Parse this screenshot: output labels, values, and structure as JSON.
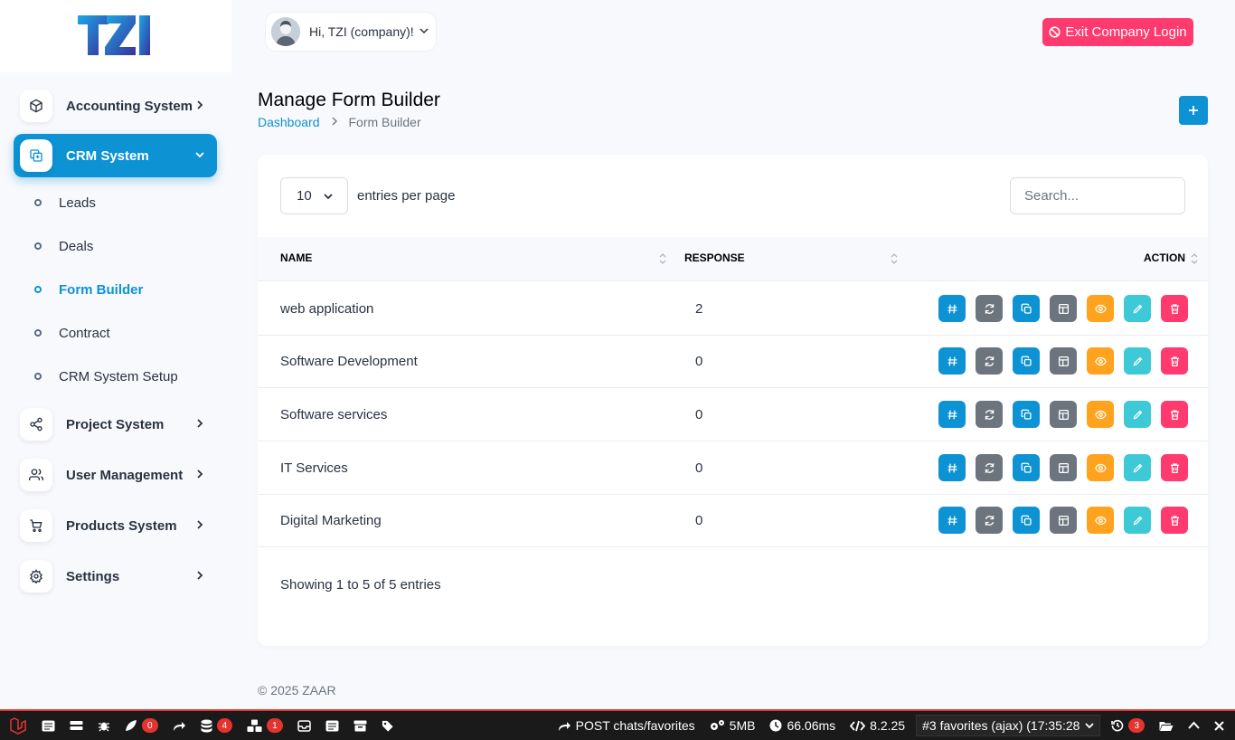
{
  "brand": {
    "logo_text": "TZI"
  },
  "sidebar": {
    "items": [
      {
        "label": "Accounting System",
        "icon": "cube-icon"
      },
      {
        "label": "CRM System",
        "icon": "copy-layers-icon",
        "active": true
      },
      {
        "label": "Project System",
        "icon": "share-icon"
      },
      {
        "label": "User Management",
        "icon": "users-icon"
      },
      {
        "label": "Products System",
        "icon": "cart-icon"
      },
      {
        "label": "Settings",
        "icon": "gear-icon"
      }
    ],
    "sub_items": [
      {
        "label": "Leads"
      },
      {
        "label": "Deals"
      },
      {
        "label": "Form Builder",
        "active": true
      },
      {
        "label": "Contract"
      },
      {
        "label": "CRM System Setup"
      }
    ]
  },
  "header": {
    "greeting": "Hi, TZI (company)!",
    "exit_label": "Exit Company Login"
  },
  "page": {
    "title": "Manage Form Builder",
    "breadcrumb": {
      "home": "Dashboard",
      "current": "Form Builder"
    }
  },
  "table": {
    "per_page": "10",
    "per_page_label": "entries per page",
    "search_placeholder": "Search...",
    "columns": {
      "name": "NAME",
      "response": "RESPONSE",
      "action": "ACTION"
    },
    "rows": [
      {
        "name": "web application",
        "response": "2"
      },
      {
        "name": "Software Development",
        "response": "0"
      },
      {
        "name": "Software services",
        "response": "0"
      },
      {
        "name": "IT Services",
        "response": "0"
      },
      {
        "name": "Digital Marketing",
        "response": "0"
      }
    ],
    "action_buttons": [
      {
        "icon": "hash-icon",
        "color": "#0d92d4"
      },
      {
        "icon": "refresh-icon",
        "color": "#6c757d"
      },
      {
        "icon": "copy-icon",
        "color": "#0d92d4"
      },
      {
        "icon": "table-icon",
        "color": "#6c757d"
      },
      {
        "icon": "eye-icon",
        "color": "#ffa21d"
      },
      {
        "icon": "pencil-icon",
        "color": "#3ec9d6"
      },
      {
        "icon": "trash-icon",
        "color": "#ff3a6e"
      }
    ],
    "showing": "Showing 1 to 5 of 5 entries"
  },
  "footer": {
    "copyright": "© 2025 ZAAR"
  },
  "debugbar": {
    "badges": {
      "messages": "0",
      "queries": "4",
      "models": "1",
      "history": "3"
    },
    "request": "POST chats/favorites",
    "memory": "5MB",
    "time": "66.06ms",
    "php_version": "8.2.25",
    "request_select": "#3 favorites (ajax) (17:35:28"
  },
  "colors": {
    "primary": "#0d92d4",
    "danger": "#ff3a6e",
    "warning": "#ffa21d",
    "info": "#3ec9d6",
    "secondary": "#6c757d"
  }
}
